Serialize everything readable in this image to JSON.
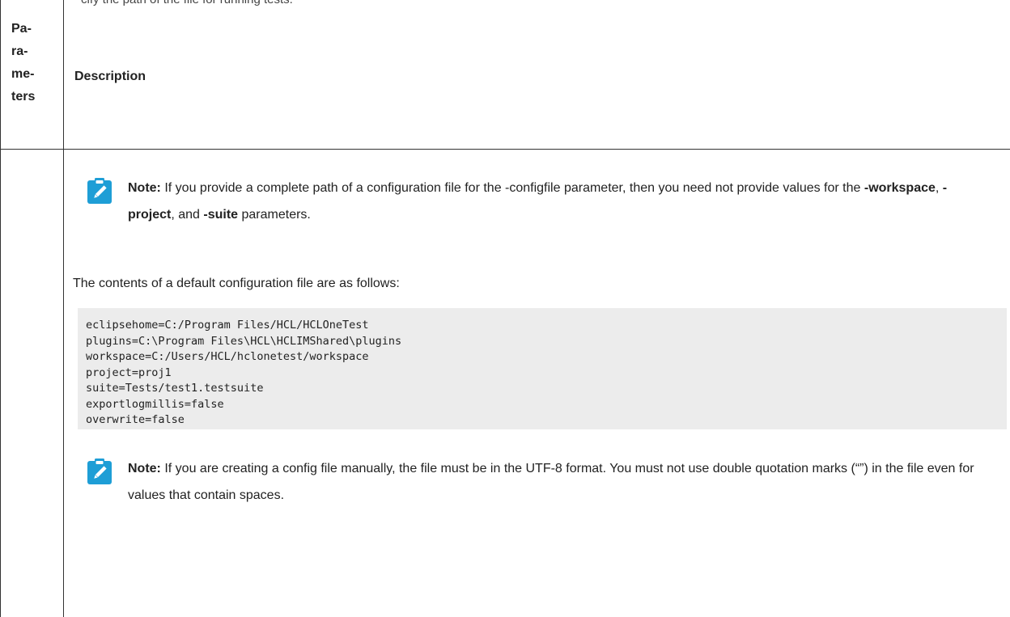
{
  "top_fragment": "cify the path of the file for running tests.",
  "table": {
    "header": {
      "param_lines": [
        "Pa-",
        "ra-",
        "me-",
        "ters"
      ],
      "description": "Description"
    }
  },
  "note1": {
    "label": "Note:",
    "t1": " If you provide a complete path of a configuration file for the -configfile parameter, then you need not provide values for the ",
    "b1": "-workspace",
    "t2": ", ",
    "b2": "-project",
    "t3": ", and ",
    "b3": "-suite",
    "t4": " parameters."
  },
  "contents_intro": "The contents of a default configuration file are as follows:",
  "code_lines": [
    "eclipsehome=C:/Program Files/HCL/HCLOneTest",
    "plugins=C:\\Program Files\\HCL\\HCLIMShared\\plugins",
    "workspace=C:/Users/HCL/hclonetest/workspace",
    "project=proj1",
    "suite=Tests/test1.testsuite",
    "exportlogmillis=false",
    "overwrite=false"
  ],
  "note2": {
    "label": "Note:",
    "text": " If you are creating a config file manually, the file must be in the UTF-8 format. You must not use double quotation marks (“”) in the file even for values that contain spaces."
  },
  "colors": {
    "note_icon": "#1e9ed6",
    "code_bg": "#ececec"
  },
  "icons": {
    "note": "pencil-icon"
  }
}
